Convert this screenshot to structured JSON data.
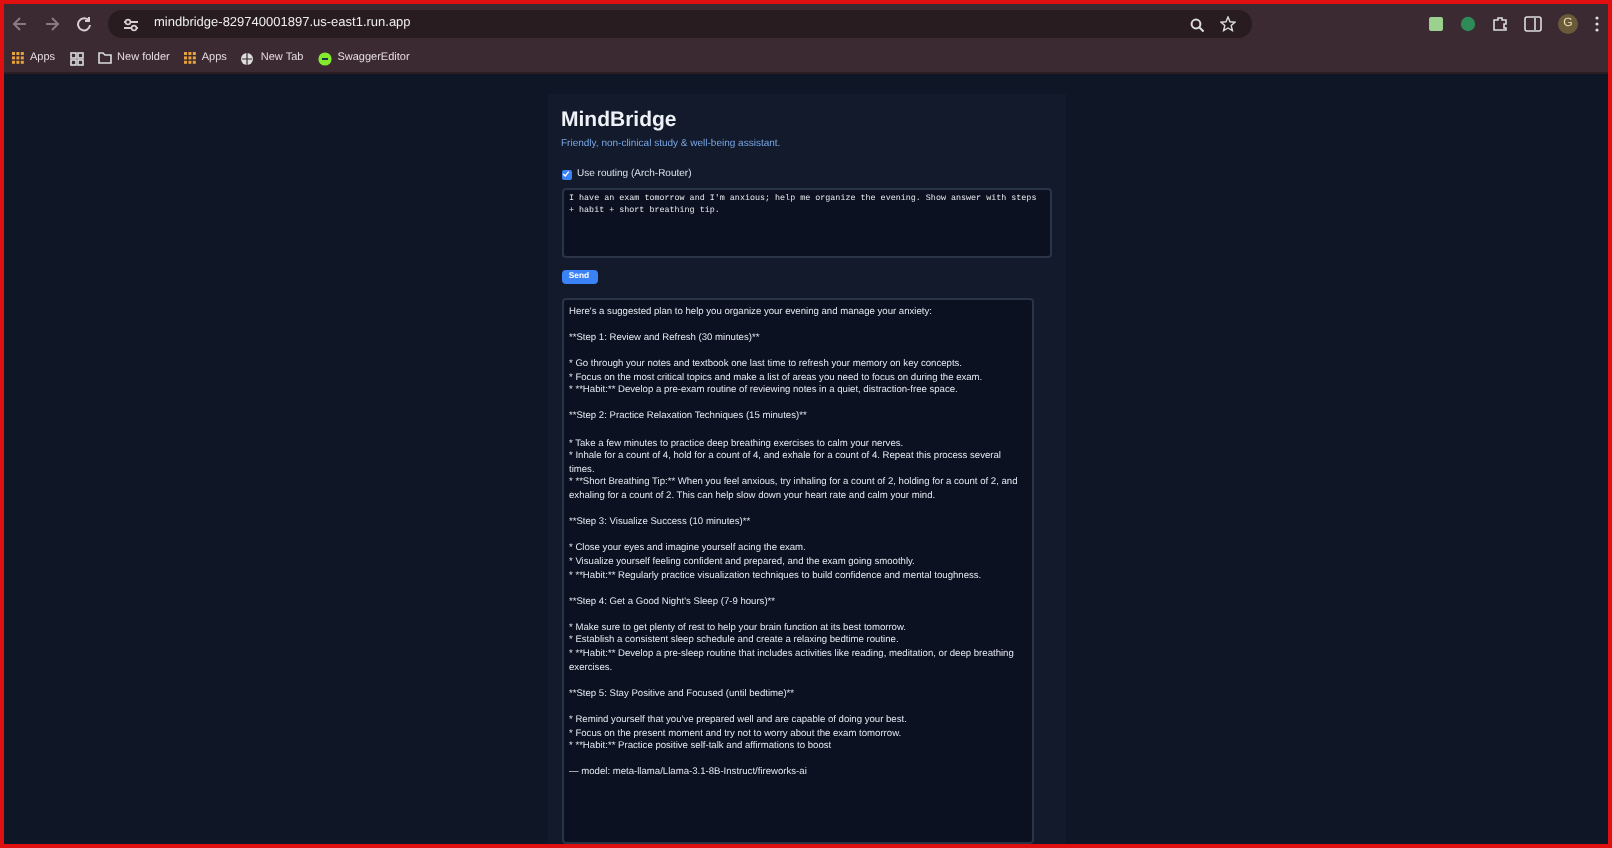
{
  "browser": {
    "url": "mindbridge-829740001897.us-east1.run.app",
    "profile_initial": "G",
    "bookmarks": [
      {
        "kind": "apps",
        "label": "Apps"
      },
      {
        "kind": "grid"
      },
      {
        "kind": "folder",
        "label": "New folder"
      },
      {
        "kind": "apps",
        "label": "Apps"
      },
      {
        "kind": "globe",
        "label": "New Tab"
      },
      {
        "kind": "swagger",
        "label": "SwaggerEditor"
      }
    ]
  },
  "app": {
    "title": "MindBridge",
    "subtitle": "Friendly, non-clinical study & well-being assistant.",
    "routing": {
      "label": "Use routing (Arch-Router)",
      "checked": true
    },
    "prompt": "I have an exam tomorrow and I'm anxious; help me organize the evening. Show answer with steps + habit + short breathing tip.",
    "send_button": "Send",
    "response": [
      [
        "Here's a suggested plan to help you organize your evening and manage your anxiety:"
      ],
      [
        "**Step 1: Review and Refresh (30 minutes)**"
      ],
      [
        "* Go through your notes and textbook one last time to refresh your memory on key concepts.",
        "* Focus on the most critical topics and make a list of areas you need to focus on during the exam.",
        "* **Habit:** Develop a pre-exam routine of reviewing notes in a quiet, distraction-free space."
      ],
      [
        "**Step 2: Practice Relaxation Techniques (15 minutes)**"
      ],
      [
        "* Take a few minutes to practice deep breathing exercises to calm your nerves.",
        "* Inhale for a count of 4, hold for a count of 4, and exhale for a count of 4. Repeat this process several times.",
        "* **Short Breathing Tip:** When you feel anxious, try inhaling for a count of 2, holding for a count of 2, and exhaling for a count of 2. This can help slow down your heart rate and calm your mind."
      ],
      [
        "**Step 3: Visualize Success (10 minutes)**"
      ],
      [
        "* Close your eyes and imagine yourself acing the exam.",
        "* Visualize yourself feeling confident and prepared, and the exam going smoothly.",
        "* **Habit:** Regularly practice visualization techniques to build confidence and mental toughness."
      ],
      [
        "**Step 4: Get a Good Night's Sleep (7-9 hours)**"
      ],
      [
        "* Make sure to get plenty of rest to help your brain function at its best tomorrow.",
        "* Establish a consistent sleep schedule and create a relaxing bedtime routine.",
        "* **Habit:** Develop a pre-sleep routine that includes activities like reading, meditation, or deep breathing exercises."
      ],
      [
        "**Step 5: Stay Positive and Focused (until bedtime)**"
      ],
      [
        "* Remind yourself that you've prepared well and are capable of doing your best.",
        "* Focus on the present moment and try not to worry about the exam tomorrow.",
        "* **Habit:** Practice positive self-talk and affirmations to boost"
      ],
      [
        "— model: meta-llama/Llama-3.1-8B-Instruct/fireworks-ai"
      ]
    ]
  }
}
